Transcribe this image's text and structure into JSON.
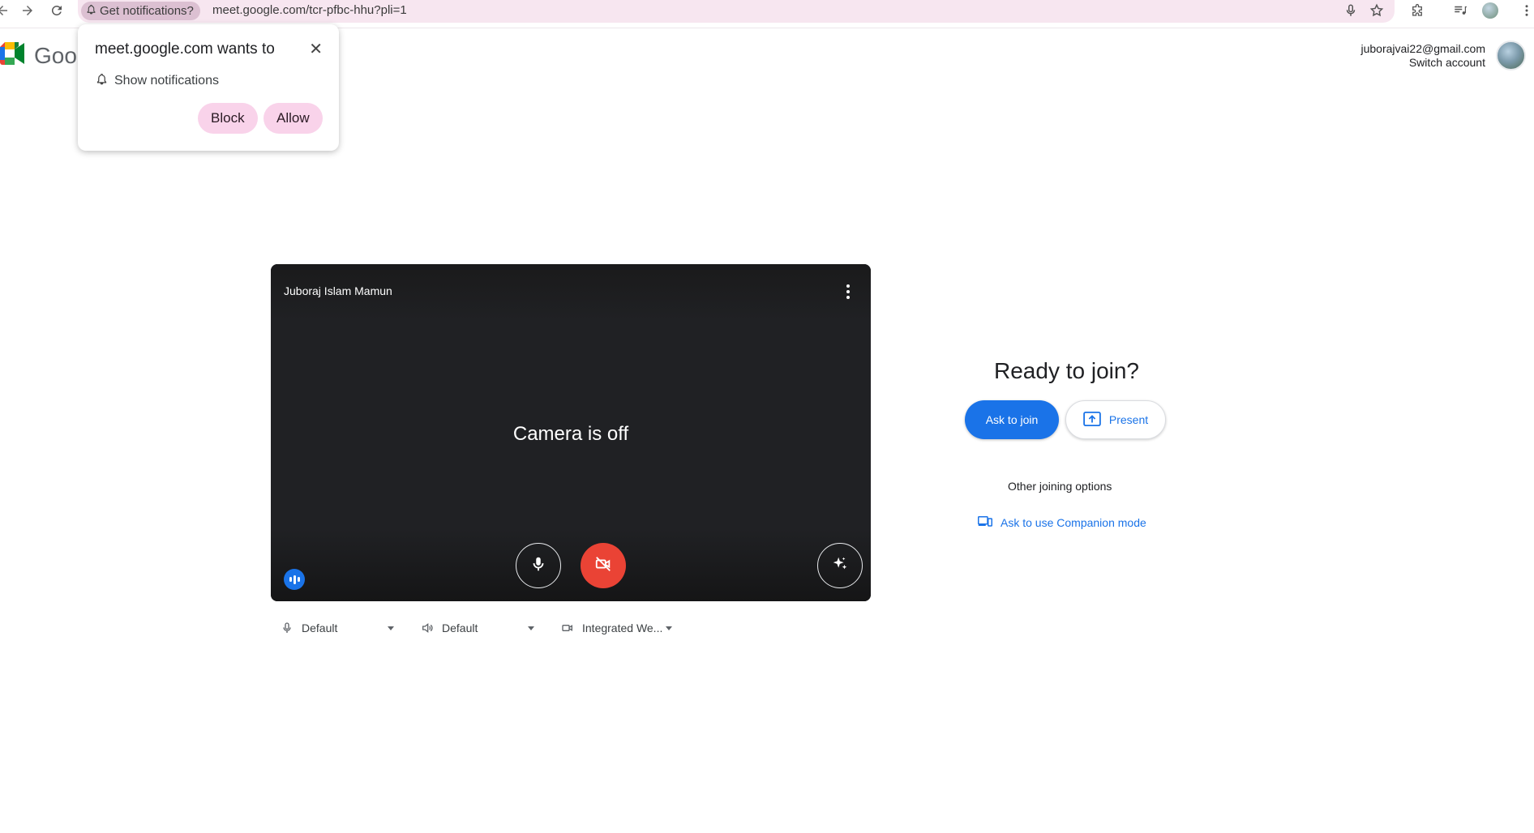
{
  "browser": {
    "notification_chip": "Get notifications?",
    "url": "meet.google.com/tcr-pfbc-hhu?pli=1"
  },
  "logo": {
    "text": "Goo"
  },
  "notification_popup": {
    "title": "meet.google.com wants to",
    "permission": "Show notifications",
    "block_label": "Block",
    "allow_label": "Allow"
  },
  "account": {
    "email": "juborajvai22@gmail.com",
    "switch_label": "Switch account"
  },
  "preview": {
    "user_name": "Juboraj Islam Mamun",
    "camera_status": "Camera is off"
  },
  "devices": {
    "microphone": "Default",
    "speaker": "Default",
    "camera": "Integrated We..."
  },
  "join_panel": {
    "heading": "Ready to join?",
    "ask_to_join_label": "Ask to join",
    "present_label": "Present",
    "other_options_label": "Other joining options",
    "companion_label": "Ask to use Companion mode"
  },
  "colors": {
    "primary_blue": "#1a73e8",
    "camera_off_red": "#ea4335",
    "preview_bg": "#202124",
    "omnibox_bg": "#f7e6f0",
    "popup_pill": "#f9d3ea"
  }
}
